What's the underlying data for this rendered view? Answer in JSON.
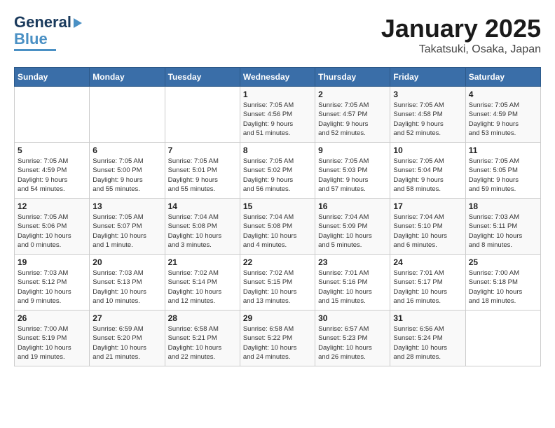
{
  "header": {
    "logo_line1": "General",
    "logo_line2": "Blue",
    "title": "January 2025",
    "subtitle": "Takatsuki, Osaka, Japan"
  },
  "days_of_week": [
    "Sunday",
    "Monday",
    "Tuesday",
    "Wednesday",
    "Thursday",
    "Friday",
    "Saturday"
  ],
  "weeks": [
    [
      {
        "num": "",
        "info": ""
      },
      {
        "num": "",
        "info": ""
      },
      {
        "num": "",
        "info": ""
      },
      {
        "num": "1",
        "info": "Sunrise: 7:05 AM\nSunset: 4:56 PM\nDaylight: 9 hours\nand 51 minutes."
      },
      {
        "num": "2",
        "info": "Sunrise: 7:05 AM\nSunset: 4:57 PM\nDaylight: 9 hours\nand 52 minutes."
      },
      {
        "num": "3",
        "info": "Sunrise: 7:05 AM\nSunset: 4:58 PM\nDaylight: 9 hours\nand 52 minutes."
      },
      {
        "num": "4",
        "info": "Sunrise: 7:05 AM\nSunset: 4:59 PM\nDaylight: 9 hours\nand 53 minutes."
      }
    ],
    [
      {
        "num": "5",
        "info": "Sunrise: 7:05 AM\nSunset: 4:59 PM\nDaylight: 9 hours\nand 54 minutes."
      },
      {
        "num": "6",
        "info": "Sunrise: 7:05 AM\nSunset: 5:00 PM\nDaylight: 9 hours\nand 55 minutes."
      },
      {
        "num": "7",
        "info": "Sunrise: 7:05 AM\nSunset: 5:01 PM\nDaylight: 9 hours\nand 55 minutes."
      },
      {
        "num": "8",
        "info": "Sunrise: 7:05 AM\nSunset: 5:02 PM\nDaylight: 9 hours\nand 56 minutes."
      },
      {
        "num": "9",
        "info": "Sunrise: 7:05 AM\nSunset: 5:03 PM\nDaylight: 9 hours\nand 57 minutes."
      },
      {
        "num": "10",
        "info": "Sunrise: 7:05 AM\nSunset: 5:04 PM\nDaylight: 9 hours\nand 58 minutes."
      },
      {
        "num": "11",
        "info": "Sunrise: 7:05 AM\nSunset: 5:05 PM\nDaylight: 9 hours\nand 59 minutes."
      }
    ],
    [
      {
        "num": "12",
        "info": "Sunrise: 7:05 AM\nSunset: 5:06 PM\nDaylight: 10 hours\nand 0 minutes."
      },
      {
        "num": "13",
        "info": "Sunrise: 7:05 AM\nSunset: 5:07 PM\nDaylight: 10 hours\nand 1 minute."
      },
      {
        "num": "14",
        "info": "Sunrise: 7:04 AM\nSunset: 5:08 PM\nDaylight: 10 hours\nand 3 minutes."
      },
      {
        "num": "15",
        "info": "Sunrise: 7:04 AM\nSunset: 5:08 PM\nDaylight: 10 hours\nand 4 minutes."
      },
      {
        "num": "16",
        "info": "Sunrise: 7:04 AM\nSunset: 5:09 PM\nDaylight: 10 hours\nand 5 minutes."
      },
      {
        "num": "17",
        "info": "Sunrise: 7:04 AM\nSunset: 5:10 PM\nDaylight: 10 hours\nand 6 minutes."
      },
      {
        "num": "18",
        "info": "Sunrise: 7:03 AM\nSunset: 5:11 PM\nDaylight: 10 hours\nand 8 minutes."
      }
    ],
    [
      {
        "num": "19",
        "info": "Sunrise: 7:03 AM\nSunset: 5:12 PM\nDaylight: 10 hours\nand 9 minutes."
      },
      {
        "num": "20",
        "info": "Sunrise: 7:03 AM\nSunset: 5:13 PM\nDaylight: 10 hours\nand 10 minutes."
      },
      {
        "num": "21",
        "info": "Sunrise: 7:02 AM\nSunset: 5:14 PM\nDaylight: 10 hours\nand 12 minutes."
      },
      {
        "num": "22",
        "info": "Sunrise: 7:02 AM\nSunset: 5:15 PM\nDaylight: 10 hours\nand 13 minutes."
      },
      {
        "num": "23",
        "info": "Sunrise: 7:01 AM\nSunset: 5:16 PM\nDaylight: 10 hours\nand 15 minutes."
      },
      {
        "num": "24",
        "info": "Sunrise: 7:01 AM\nSunset: 5:17 PM\nDaylight: 10 hours\nand 16 minutes."
      },
      {
        "num": "25",
        "info": "Sunrise: 7:00 AM\nSunset: 5:18 PM\nDaylight: 10 hours\nand 18 minutes."
      }
    ],
    [
      {
        "num": "26",
        "info": "Sunrise: 7:00 AM\nSunset: 5:19 PM\nDaylight: 10 hours\nand 19 minutes."
      },
      {
        "num": "27",
        "info": "Sunrise: 6:59 AM\nSunset: 5:20 PM\nDaylight: 10 hours\nand 21 minutes."
      },
      {
        "num": "28",
        "info": "Sunrise: 6:58 AM\nSunset: 5:21 PM\nDaylight: 10 hours\nand 22 minutes."
      },
      {
        "num": "29",
        "info": "Sunrise: 6:58 AM\nSunset: 5:22 PM\nDaylight: 10 hours\nand 24 minutes."
      },
      {
        "num": "30",
        "info": "Sunrise: 6:57 AM\nSunset: 5:23 PM\nDaylight: 10 hours\nand 26 minutes."
      },
      {
        "num": "31",
        "info": "Sunrise: 6:56 AM\nSunset: 5:24 PM\nDaylight: 10 hours\nand 28 minutes."
      },
      {
        "num": "",
        "info": ""
      }
    ]
  ]
}
